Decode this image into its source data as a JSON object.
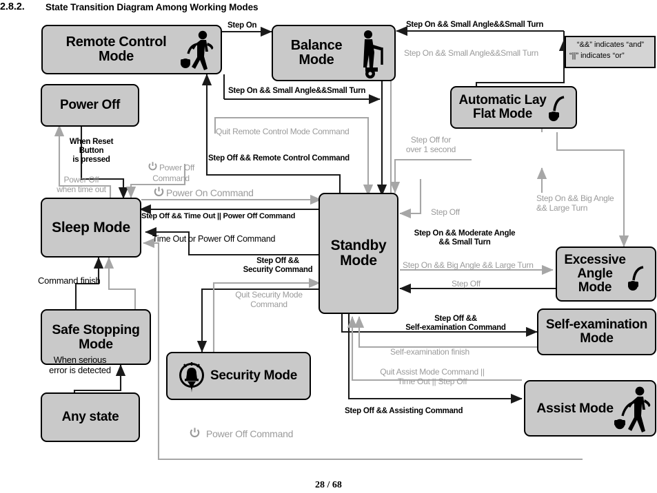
{
  "heading": {
    "number": "2.8.2.",
    "title": "State Transition Diagram Among Working Modes"
  },
  "footer": {
    "page": "28 / 68"
  },
  "legend": {
    "line1": "“&&” indicates “and”",
    "line2": "“||” indicates “or”"
  },
  "nodes": {
    "remote_control": {
      "label": "Remote Control\nMode",
      "icon": "person-walking-with-scooter-icon"
    },
    "balance": {
      "label": "Balance\nMode",
      "icon": "person-riding-scooter-icon"
    },
    "power_off": {
      "label": "Power Off",
      "icon": ""
    },
    "auto_lay_flat": {
      "label": "Automatic Lay\nFlat Mode",
      "icon": "scooter-icon"
    },
    "sleep": {
      "label": "Sleep Mode",
      "icon": ""
    },
    "standby": {
      "label": "Standby\nMode",
      "icon": ""
    },
    "excessive_angle": {
      "label": "Excessive\nAngle\nMode",
      "icon": "scooter-icon"
    },
    "safe_stopping": {
      "label": "Safe Stopping\nMode",
      "icon": ""
    },
    "self_exam": {
      "label": "Self-examination\nMode",
      "icon": ""
    },
    "security": {
      "label": "Security Mode",
      "icon": "alarm-bell-icon"
    },
    "any_state": {
      "label": "Any state",
      "icon": ""
    },
    "assist": {
      "label": "Assist Mode",
      "icon": "person-walking-with-scooter-icon"
    }
  },
  "transitions": {
    "step_on": "Step On",
    "balance_to_standby": "Step On && Small Angle&&Small Turn",
    "standby_to_balance_grey": "Step On && Small Angle&&Small Turn",
    "remote_to_balance_small": "Step On && Small Angle&&Small Turn",
    "quit_remote": "Quit Remote Control Mode Command",
    "step_off_remote": "Step Off && Remote Control Command",
    "when_reset": "When Reset\nButton\nis pressed",
    "power_off_cmd_top": "Power Off\nCommand",
    "power_off_time_out": "Power Off\nwhen time out",
    "power_on_cmd": "Power On Command",
    "step_off_timeout": "Step Off && Time Out || Power Off Command",
    "time_out_or_power_off": "Time Out or Power Off Command",
    "command_finish": "Command finish",
    "step_off_security": "Step Off &&\nSecurity Command",
    "quit_security": "Quit Security Mode\nCommand",
    "when_serious_error": "When serious\nerror is detected",
    "step_off_over_1s": "Step Off for\nover 1 second",
    "step_off_mid": "Step Off",
    "step_on_moderate": "Step On && Moderate Angle\n&& Small Turn",
    "step_on_big_angle_v": "Step On && Big Angle\n&& Large Turn",
    "step_on_big_angle_h": "Step On && Big Angle && Large Turn",
    "step_off_excessive": "Step Off",
    "step_off_self_exam": "Step Off &&\nSelf-examination Command",
    "self_exam_finish": "Self-examination finish",
    "quit_assist": "Quit Assist Mode Command ||\nTime Out || Step Off",
    "step_off_assisting": "Step Off && Assisting Command",
    "power_off_cmd_bottom": "Power Off Command"
  },
  "colors": {
    "node_fill": "#c9c9c9",
    "node_stroke": "#000000",
    "edge_dark": "#1a1a1a",
    "edge_grey": "#a6a6a6",
    "label_grey": "#9a9a9a",
    "legend_fill": "#d4d4d4"
  }
}
